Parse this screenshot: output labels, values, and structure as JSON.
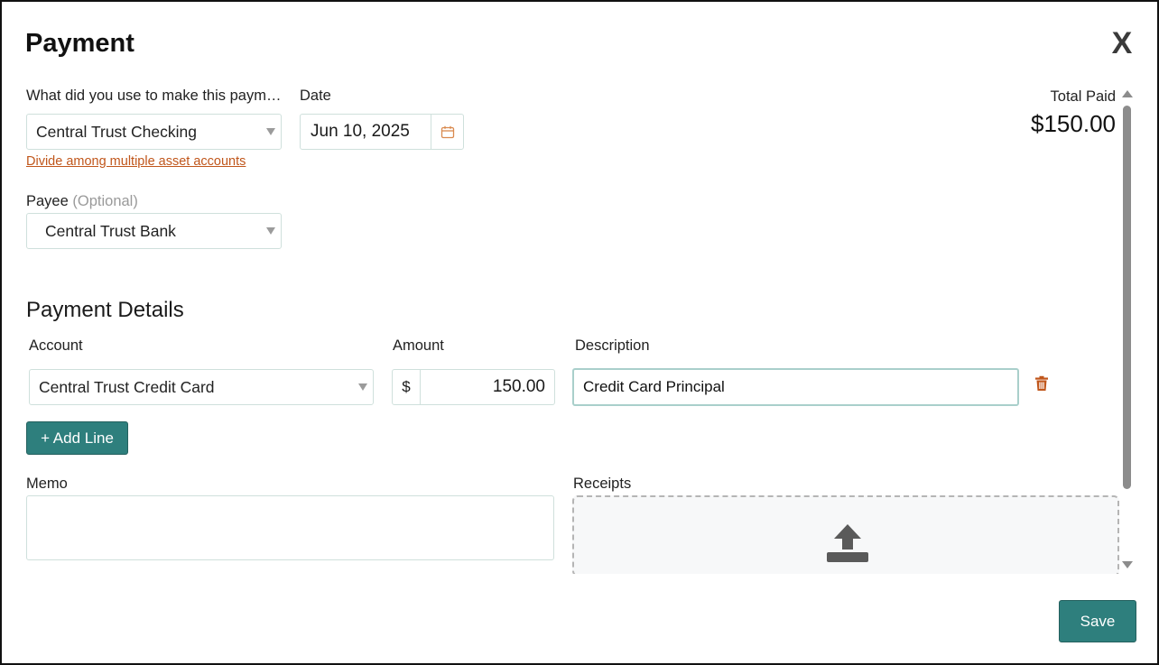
{
  "dialog": {
    "title": "Payment",
    "close_label": "X"
  },
  "form": {
    "source_label": "What did you use to make this paym…",
    "source_value": "Central Trust Checking",
    "divide_link": "Divide among multiple asset accounts",
    "date_label": "Date",
    "date_value": "Jun 10, 2025",
    "payee_label": "Payee",
    "payee_optional": "(Optional)",
    "payee_value": "Central Trust Bank"
  },
  "summary": {
    "total_label": "Total Paid",
    "total_value": "$150.00"
  },
  "details": {
    "title": "Payment Details",
    "account_header": "Account",
    "amount_header": "Amount",
    "description_header": "Description",
    "lines": [
      {
        "account": "Central Trust Credit Card",
        "currency": "$",
        "amount": "150.00",
        "description": "Credit Card Principal"
      }
    ],
    "add_line_label": "+ Add Line"
  },
  "memo": {
    "label": "Memo",
    "value": ""
  },
  "receipts": {
    "label": "Receipts"
  },
  "footer": {
    "save_label": "Save"
  },
  "colors": {
    "accent": "#2e7f7d",
    "link": "#c0561b",
    "trash": "#c0561b"
  },
  "icons": [
    "close-icon",
    "calendar-icon",
    "trash-icon",
    "upload-icon",
    "chevron-down-icon"
  ]
}
